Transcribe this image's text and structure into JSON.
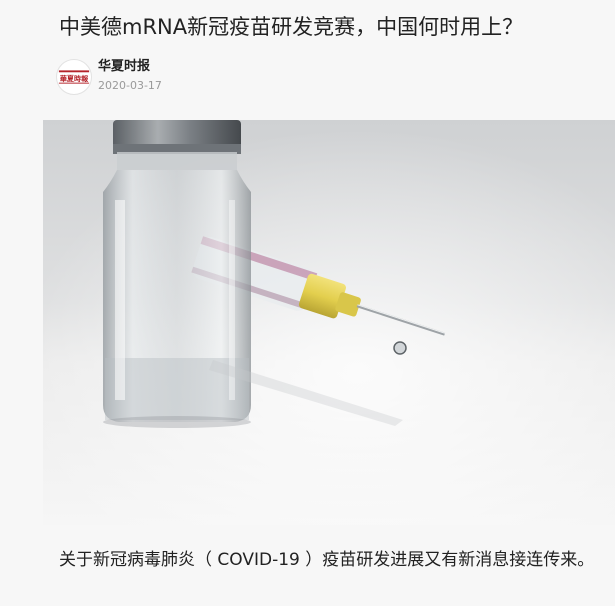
{
  "article": {
    "title": "中美德mRNA新冠疫苗研发竞赛，中国何时用上？",
    "source": {
      "name": "华夏时报",
      "date": "2020-03-17",
      "logo_text": "華夏時報",
      "logo_icon": "newspaper-logo-icon"
    },
    "image": {
      "subject": "vaccine-vial-and-syringe-photo"
    },
    "lead": "关于新冠病毒肺炎（ COVID-19 ）疫苗研发进展又有新消息接连传来。"
  },
  "colors": {
    "background": "#f7f7f7",
    "title_text": "#222222",
    "meta_text": "#9a9a9a",
    "logo_red": "#b4232a"
  }
}
